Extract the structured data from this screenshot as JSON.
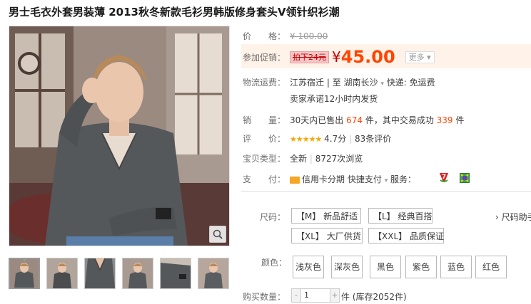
{
  "title": "男士毛衣外套男装薄 2013秋冬新款毛衫男韩版修身套头V领针织衫潮",
  "price": {
    "label": "价　　格：",
    "original": "¥ 100.00"
  },
  "promo": {
    "label": "参加促销：",
    "tag": "拍下24元",
    "yen": "¥",
    "price": "45.00",
    "more": "更多 ▾"
  },
  "shipping": {
    "label": "物流运费：",
    "from": "江苏宿迁",
    "sep": "| 至",
    "to": "湖南长沙",
    "caret": "▾",
    "fee": "快递: 免运费",
    "promise": "卖家承诺12小时内发货"
  },
  "sales": {
    "label": "销　　量：",
    "pre": "30天内已售出 ",
    "sold": "674",
    "mid": " 件，其中交易成功 ",
    "success": "339",
    "post": " 件"
  },
  "rating": {
    "label": "评　　价：",
    "stars": "★★★★★",
    "score": "4.7分",
    "sep": "|",
    "reviews": "83条评价"
  },
  "type": {
    "label": "宝贝类型：",
    "value": "全新",
    "sep": "|",
    "views": "8727次浏览"
  },
  "payment": {
    "label": "支　　付：",
    "credit": "信用卡分期",
    "fast": "快捷支付",
    "caret": "▾",
    "service": "服务："
  },
  "size": {
    "label": "尺码：",
    "options": [
      "【M】 新品舒适",
      "【L】 经典百搭",
      "【XL】 大厂供货",
      "【XXL】 品质保证"
    ],
    "helper": "› 尺码助手"
  },
  "colors": {
    "label": "颜色：",
    "options": [
      "浅灰色",
      "深灰色",
      "黑色",
      "紫色",
      "蓝色",
      "红色"
    ]
  },
  "quantity": {
    "label": "购买数量：",
    "minus": "-",
    "value": "1",
    "plus": "+",
    "stock": "件 (库存2052件)"
  },
  "accent": {
    "orange": "#ff4400",
    "red": "#c40000",
    "star": "#f7a500"
  }
}
